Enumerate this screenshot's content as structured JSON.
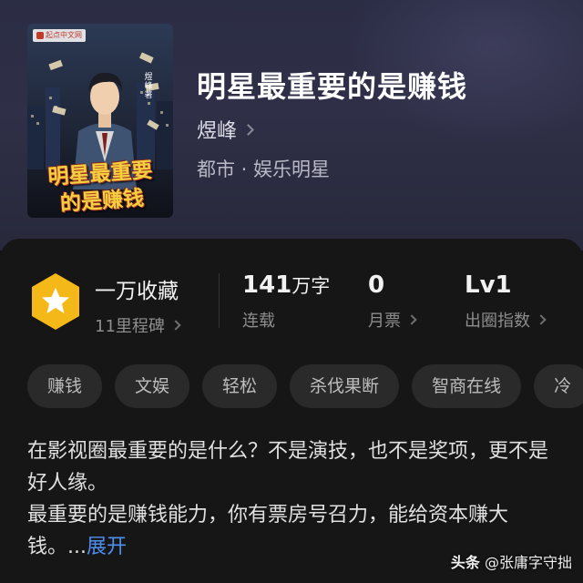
{
  "book": {
    "title": "明星最重要的是赚钱",
    "author": "煜峰",
    "genre": "都市 · 娱乐明星",
    "cover": {
      "publisher_logo": "起点中文网",
      "author_tag": "煜峰著",
      "title_line1": "明星最重要",
      "title_line2": "的是赚钱"
    }
  },
  "stats": {
    "favorites": {
      "main": "一万收藏",
      "sub": "11里程碑"
    },
    "words": {
      "number": "141",
      "unit": "万字",
      "sub": "连载"
    },
    "tickets": {
      "main": "0",
      "sub": "月票"
    },
    "level": {
      "main": "Lv1",
      "sub": "出圈指数"
    }
  },
  "tags": [
    "赚钱",
    "文娱",
    "轻松",
    "杀伐果断",
    "智商在线",
    "冷"
  ],
  "description": {
    "para1": "在影视圈最重要的是什么？不是演技，也不是奖项，更不是好人缘。",
    "para2": "最重要的是赚钱能力，你有票房号召力，能给资本赚大钱。...",
    "expand_label": "展开"
  },
  "watermark": {
    "brand": "头条",
    "handle": "@张庸字守拙"
  },
  "colors": {
    "header_bg": "#2f2f47",
    "card_bg": "#161616",
    "accent_blue": "#4e8ff0",
    "badge_gold": "#f5b819"
  }
}
